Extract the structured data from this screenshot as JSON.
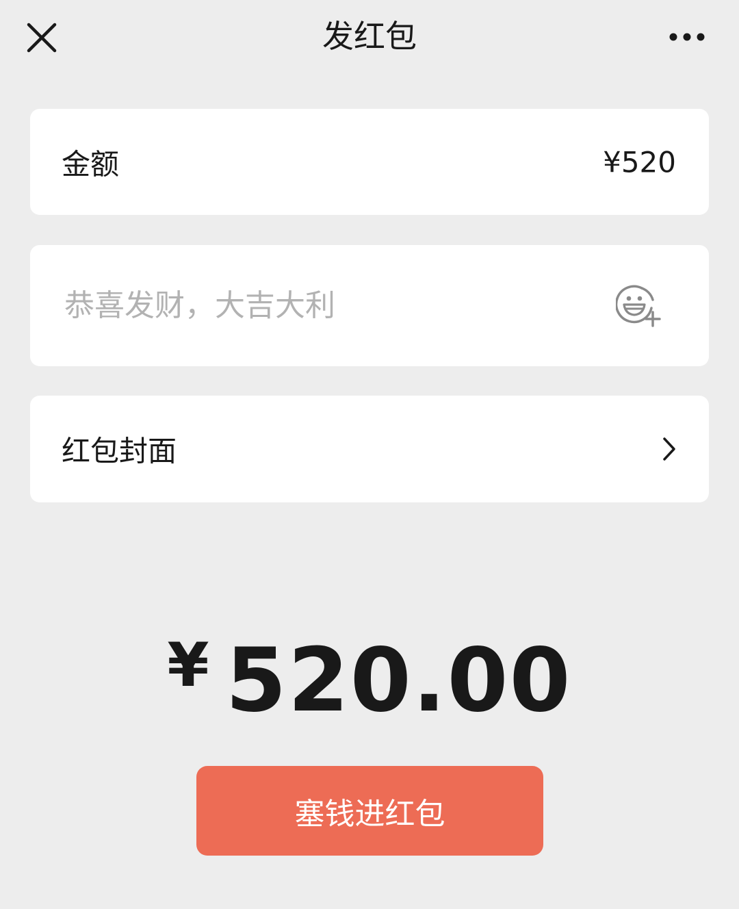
{
  "header": {
    "title": "发红包",
    "close_icon": "close-icon",
    "more_icon": "more-dots-icon"
  },
  "amount_row": {
    "label": "金额",
    "value": "¥520"
  },
  "greeting_row": {
    "placeholder": "恭喜发财，大吉大利",
    "value": "",
    "icon": "emoji-add-icon"
  },
  "cover_row": {
    "label": "红包封面",
    "icon": "chevron-right-icon"
  },
  "total": {
    "currency": "¥",
    "amount": "520.00"
  },
  "send_button": {
    "label": "塞钱进红包"
  },
  "colors": {
    "background": "#ededed",
    "card": "#ffffff",
    "accent": "#ed6c55",
    "placeholder": "#b2b2b2"
  }
}
